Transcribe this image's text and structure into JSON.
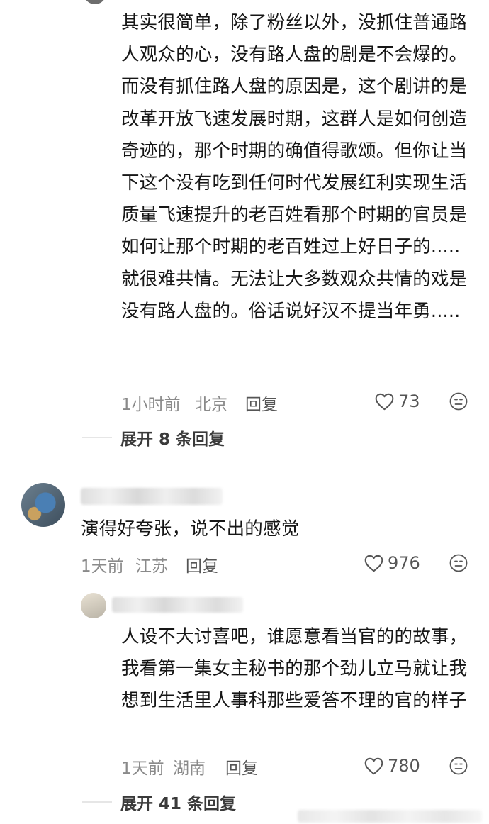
{
  "comments": [
    {
      "text": "其实很简单，除了粉丝以外，没抓住普通路人观众的心，没有路人盘的剧是不会爆的。而没有抓住路人盘的原因是，这个剧讲的是改革开放飞速发展时期，这群人是如何创造奇迹的，那个时期的确值得歌颂。但你让当下这个没有吃到任何时代发展红利实现生活质量飞速提升的老百姓看那个时期的官员是如何让那个时期的老百姓过上好日子的.....就很难共情。无法让大多数观众共情的戏是没有路人盘的。俗话说好汉不提当年勇.....",
      "time": "1小时前",
      "location": "北京",
      "reply_label": "回复",
      "likes": "73",
      "expand": "展开 8 条回复"
    },
    {
      "text": "演得好夸张，说不出的感觉",
      "time": "1天前",
      "location": "江苏",
      "reply_label": "回复",
      "likes": "976"
    },
    {
      "text": "人设不大讨喜吧，谁愿意看当官的的故事，我看第一集女主秘书的那个劲儿立马就让我想到生活里人事科那些爱答不理的官的样子",
      "time": "1天前",
      "location": "湖南",
      "reply_label": "回复",
      "likes": "780",
      "expand": "展开 41 条回复"
    }
  ],
  "colors": {
    "text": "#161616",
    "meta": "#8a8a8a",
    "action": "#555555"
  },
  "icons": {
    "like": "heart-outline-icon",
    "dislike": "neutral-face-icon"
  }
}
